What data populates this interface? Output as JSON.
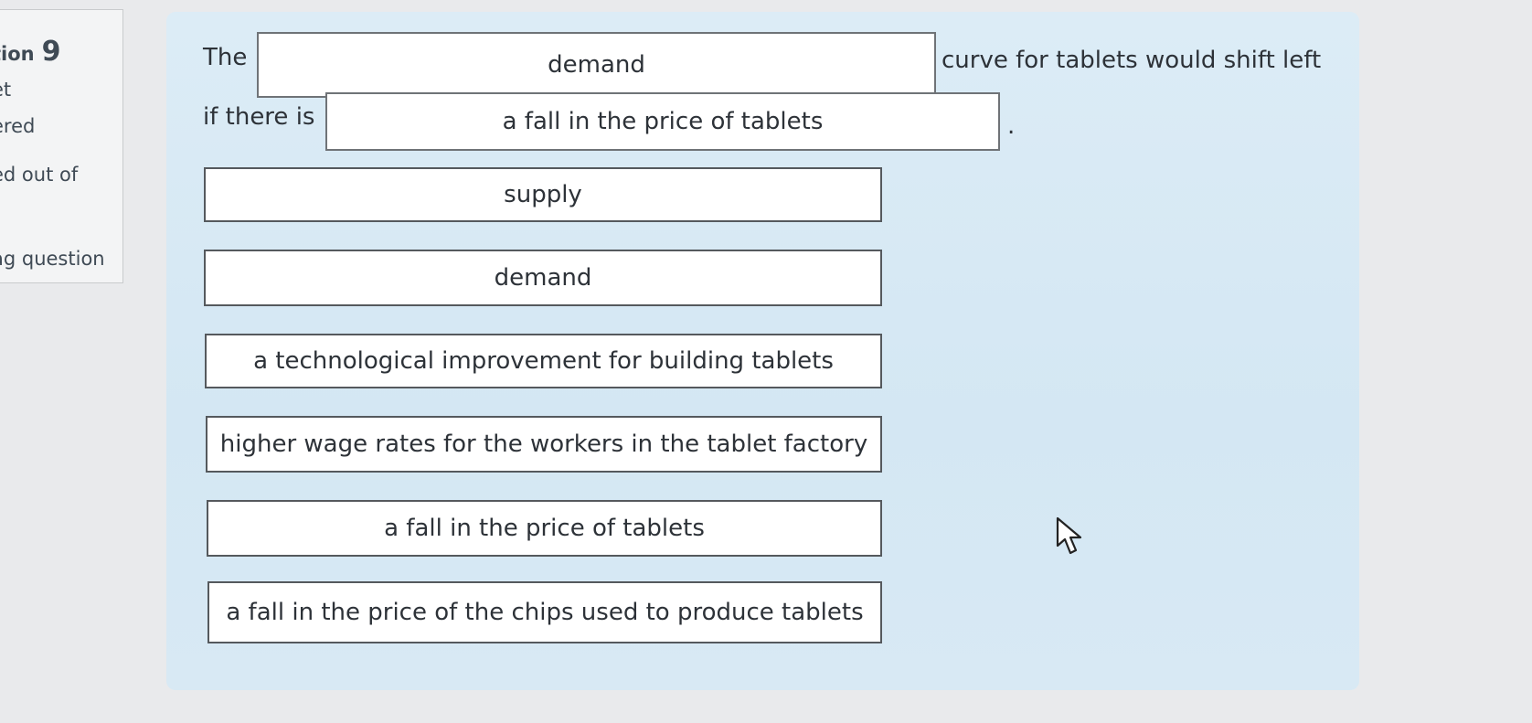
{
  "info_panel": {
    "question_label": "tion",
    "question_number": "9",
    "state": "et",
    "status": "ered",
    "mark": "ed out of",
    "flag": "ag question"
  },
  "sentence": {
    "part1": "The",
    "blank1_value": "demand",
    "part2": "curve for tablets would shift left",
    "part3": "if there is",
    "blank2_value": "a fall in the price of tablets",
    "end_punct": "."
  },
  "choices": [
    {
      "label": "supply"
    },
    {
      "label": "demand"
    },
    {
      "label": "a technological improvement for building tablets"
    },
    {
      "label": "higher wage rates for the workers in the tablet factory"
    },
    {
      "label": "a fall in the price of tablets"
    },
    {
      "label": "a fall in the price of the chips used to produce tablets"
    }
  ],
  "icons": {
    "cursor": "mouse-pointer-icon"
  }
}
